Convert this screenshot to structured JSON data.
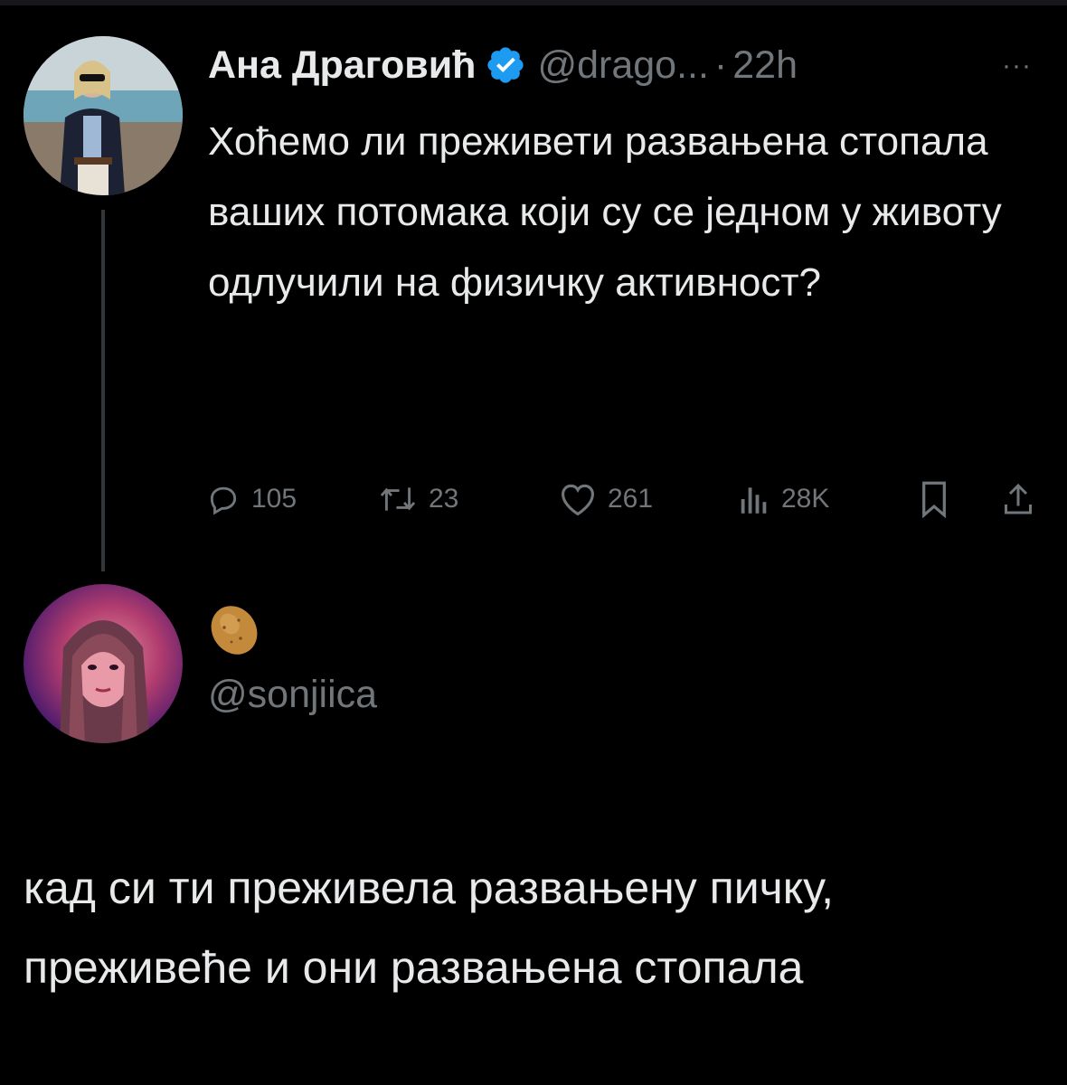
{
  "tweet": {
    "display_name": "Ана Драговић",
    "handle": "@drago...",
    "separator": "·",
    "time": "22h",
    "more": "···",
    "text": "Хоћемо ли преживети развањена стопала ваших потомака који су се једном у животу одлучили на физичку активност?",
    "stats": {
      "replies": "105",
      "retweets": "23",
      "likes": "261",
      "views": "28K"
    }
  },
  "reply": {
    "emoji": "potato",
    "handle": "@sonjiica"
  },
  "caption": "кад си ти преживела развањену пичку, преживеће и они развањена стопала",
  "colors": {
    "background": "#000000",
    "text_primary": "#e7e9ea",
    "text_secondary": "#71767b",
    "verified": "#1d9bf0",
    "thread_line": "#333639"
  }
}
